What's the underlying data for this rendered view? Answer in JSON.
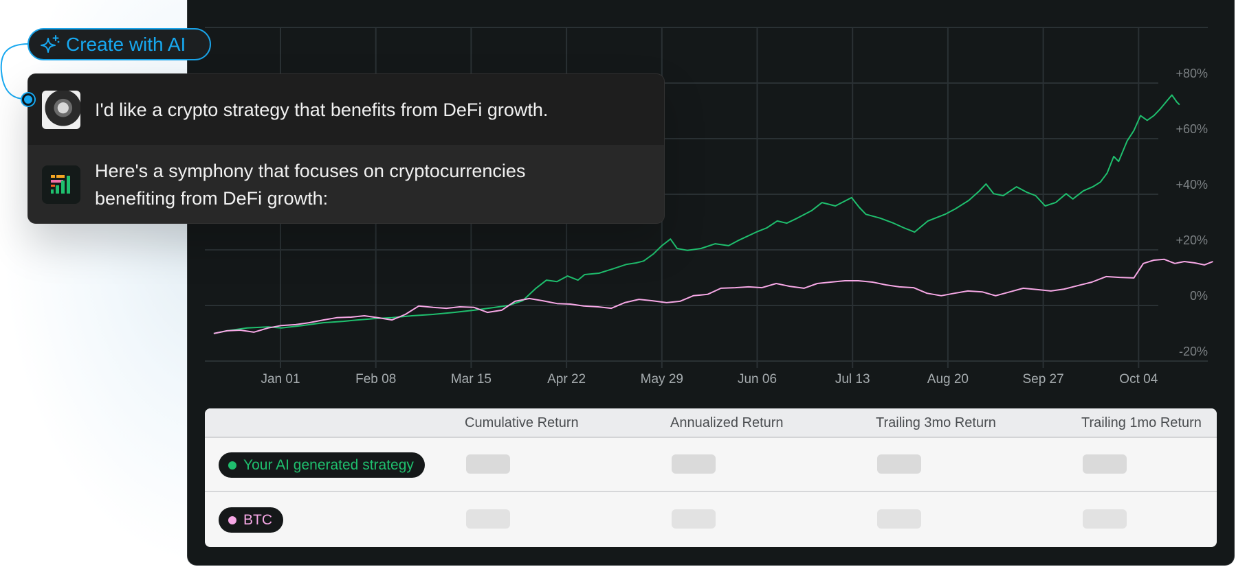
{
  "create_button": {
    "label": "Create with AI",
    "icon": "sparkle-icon",
    "color": "#17a8f0"
  },
  "chat": {
    "messages": [
      {
        "role": "user",
        "avatar": "user-photo-avatar",
        "text": "I'd like a crypto strategy that benefits from DeFi growth."
      },
      {
        "role": "assistant",
        "avatar": "symphony-bars-icon",
        "text_line1": "Here's a symphony that focuses on cryptocurrencies",
        "text_line2": "benefiting from DeFi growth:"
      }
    ]
  },
  "colors": {
    "strategy": "#1fbf6e",
    "btc": "#f7a8e6",
    "grid": "#2a3134",
    "panel_bg": "#141819"
  },
  "chart_data": {
    "type": "line",
    "title": "",
    "xlabel": "",
    "ylabel": "",
    "x_unit": "tick index (0 = Jan 01, 1 = Feb 08, ...)",
    "x_ticks": [
      "Jan 01",
      "Feb 08",
      "Mar 15",
      "Apr 22",
      "May 29",
      "Jun 06",
      "Jul 13",
      "Aug 20",
      "Sep 27",
      "Oct 04"
    ],
    "xlim": [
      -0.79,
      9.73
    ],
    "y_ticks": [
      "+80%",
      "+60%",
      "+40%",
      "+20%",
      "0%",
      "-20%"
    ],
    "y_tick_values": [
      80,
      60,
      40,
      20,
      0,
      -20
    ],
    "ylim": [
      -20,
      90
    ],
    "grid": true,
    "y_axis_side": "right",
    "series": [
      {
        "name": "Your AI generated strategy",
        "color": "#1fbf6e",
        "points": [
          [
            -0.7,
            -10.1
          ],
          [
            -0.56,
            -9.1
          ],
          [
            -0.35,
            -8.1
          ],
          [
            -0.13,
            -7.7
          ],
          [
            0.01,
            -8.1
          ],
          [
            0.23,
            -7.2
          ],
          [
            0.45,
            -6.2
          ],
          [
            0.66,
            -5.7
          ],
          [
            0.81,
            -5.2
          ],
          [
            1.0,
            -4.7
          ],
          [
            1.17,
            -4.4
          ],
          [
            1.38,
            -3.7
          ],
          [
            1.6,
            -3.2
          ],
          [
            1.82,
            -2.5
          ],
          [
            2.03,
            -1.7
          ],
          [
            2.25,
            -0.7
          ],
          [
            2.39,
            0.0
          ],
          [
            2.54,
            1.7
          ],
          [
            2.68,
            6.2
          ],
          [
            2.79,
            9.1
          ],
          [
            2.9,
            8.6
          ],
          [
            3.01,
            10.6
          ],
          [
            3.12,
            9.1
          ],
          [
            3.19,
            11.1
          ],
          [
            3.34,
            11.6
          ],
          [
            3.48,
            13.1
          ],
          [
            3.63,
            14.8
          ],
          [
            3.73,
            15.3
          ],
          [
            3.81,
            16.0
          ],
          [
            3.91,
            18.5
          ],
          [
            4.0,
            21.5
          ],
          [
            4.09,
            23.9
          ],
          [
            4.16,
            20.5
          ],
          [
            4.27,
            19.8
          ],
          [
            4.41,
            20.5
          ],
          [
            4.56,
            22.2
          ],
          [
            4.7,
            21.5
          ],
          [
            4.81,
            23.5
          ],
          [
            4.99,
            26.4
          ],
          [
            5.1,
            27.9
          ],
          [
            5.21,
            30.4
          ],
          [
            5.31,
            29.6
          ],
          [
            5.42,
            31.4
          ],
          [
            5.57,
            34.1
          ],
          [
            5.68,
            37.0
          ],
          [
            5.82,
            35.8
          ],
          [
            5.99,
            38.8
          ],
          [
            6.07,
            35.3
          ],
          [
            6.14,
            32.8
          ],
          [
            6.29,
            31.4
          ],
          [
            6.43,
            29.6
          ],
          [
            6.54,
            27.9
          ],
          [
            6.65,
            26.4
          ],
          [
            6.79,
            30.4
          ],
          [
            6.97,
            32.8
          ],
          [
            7.08,
            34.8
          ],
          [
            7.22,
            37.8
          ],
          [
            7.33,
            41.2
          ],
          [
            7.4,
            43.7
          ],
          [
            7.48,
            40.2
          ],
          [
            7.58,
            39.5
          ],
          [
            7.72,
            42.7
          ],
          [
            7.83,
            40.7
          ],
          [
            7.92,
            39.5
          ],
          [
            8.02,
            35.8
          ],
          [
            8.13,
            37.0
          ],
          [
            8.24,
            40.2
          ],
          [
            8.31,
            38.3
          ],
          [
            8.42,
            41.2
          ],
          [
            8.52,
            42.7
          ],
          [
            8.6,
            44.4
          ],
          [
            8.67,
            47.6
          ],
          [
            8.74,
            53.6
          ],
          [
            8.79,
            51.8
          ],
          [
            8.88,
            59.2
          ],
          [
            8.95,
            62.9
          ],
          [
            9.02,
            68.3
          ],
          [
            9.09,
            66.6
          ],
          [
            9.16,
            68.3
          ],
          [
            9.23,
            70.8
          ],
          [
            9.3,
            73.7
          ],
          [
            9.35,
            75.7
          ],
          [
            9.4,
            73.2
          ],
          [
            9.43,
            72.2
          ]
        ]
      },
      {
        "name": "BTC",
        "color": "#f7a8e6",
        "points": [
          [
            -0.7,
            -10.1
          ],
          [
            -0.56,
            -9.1
          ],
          [
            -0.42,
            -8.9
          ],
          [
            -0.28,
            -9.6
          ],
          [
            -0.13,
            -8.1
          ],
          [
            0.01,
            -7.2
          ],
          [
            0.16,
            -6.9
          ],
          [
            0.3,
            -6.2
          ],
          [
            0.45,
            -5.2
          ],
          [
            0.59,
            -4.4
          ],
          [
            0.74,
            -4.2
          ],
          [
            0.88,
            -3.7
          ],
          [
            1.02,
            -4.4
          ],
          [
            1.17,
            -5.2
          ],
          [
            1.31,
            -3.2
          ],
          [
            1.45,
            -0.2
          ],
          [
            1.6,
            -0.7
          ],
          [
            1.74,
            -1.0
          ],
          [
            1.88,
            -0.5
          ],
          [
            2.03,
            -0.7
          ],
          [
            2.17,
            -2.5
          ],
          [
            2.32,
            -1.7
          ],
          [
            2.46,
            1.5
          ],
          [
            2.61,
            2.5
          ],
          [
            2.75,
            1.7
          ],
          [
            2.9,
            0.7
          ],
          [
            3.04,
            0.5
          ],
          [
            3.18,
            -0.2
          ],
          [
            3.33,
            -0.5
          ],
          [
            3.47,
            -1.0
          ],
          [
            3.61,
            1.0
          ],
          [
            3.76,
            2.2
          ],
          [
            3.9,
            1.7
          ],
          [
            4.05,
            1.0
          ],
          [
            4.19,
            1.5
          ],
          [
            4.33,
            3.5
          ],
          [
            4.48,
            4.0
          ],
          [
            4.62,
            6.2
          ],
          [
            4.77,
            6.4
          ],
          [
            4.91,
            6.7
          ],
          [
            5.05,
            6.4
          ],
          [
            5.2,
            7.9
          ],
          [
            5.34,
            6.9
          ],
          [
            5.49,
            6.2
          ],
          [
            5.63,
            7.9
          ],
          [
            5.77,
            8.4
          ],
          [
            5.92,
            8.9
          ],
          [
            6.06,
            8.9
          ],
          [
            6.21,
            8.4
          ],
          [
            6.35,
            7.4
          ],
          [
            6.49,
            6.7
          ],
          [
            6.64,
            6.4
          ],
          [
            6.78,
            4.4
          ],
          [
            6.93,
            3.5
          ],
          [
            7.07,
            4.4
          ],
          [
            7.21,
            5.2
          ],
          [
            7.36,
            4.9
          ],
          [
            7.5,
            3.5
          ],
          [
            7.65,
            4.9
          ],
          [
            7.79,
            6.2
          ],
          [
            7.94,
            5.7
          ],
          [
            8.08,
            5.2
          ],
          [
            8.22,
            5.9
          ],
          [
            8.37,
            7.2
          ],
          [
            8.51,
            8.4
          ],
          [
            8.66,
            10.4
          ],
          [
            8.8,
            10.1
          ],
          [
            8.95,
            9.9
          ],
          [
            9.05,
            15.1
          ],
          [
            9.16,
            16.3
          ],
          [
            9.27,
            16.6
          ],
          [
            9.38,
            15.1
          ],
          [
            9.48,
            15.8
          ],
          [
            9.59,
            15.3
          ],
          [
            9.69,
            14.6
          ],
          [
            9.78,
            15.8
          ]
        ]
      }
    ]
  },
  "table": {
    "columns": [
      "",
      "Cumulative Return",
      "Annualized Return",
      "Trailing 3mo Return",
      "Trailing 1mo Return"
    ],
    "rows": [
      {
        "label": "Your AI generated strategy",
        "color": "#1fbf6e",
        "values_state": "loading"
      },
      {
        "label": "BTC",
        "color": "#f7a8e6",
        "values_state": "loading"
      }
    ]
  }
}
